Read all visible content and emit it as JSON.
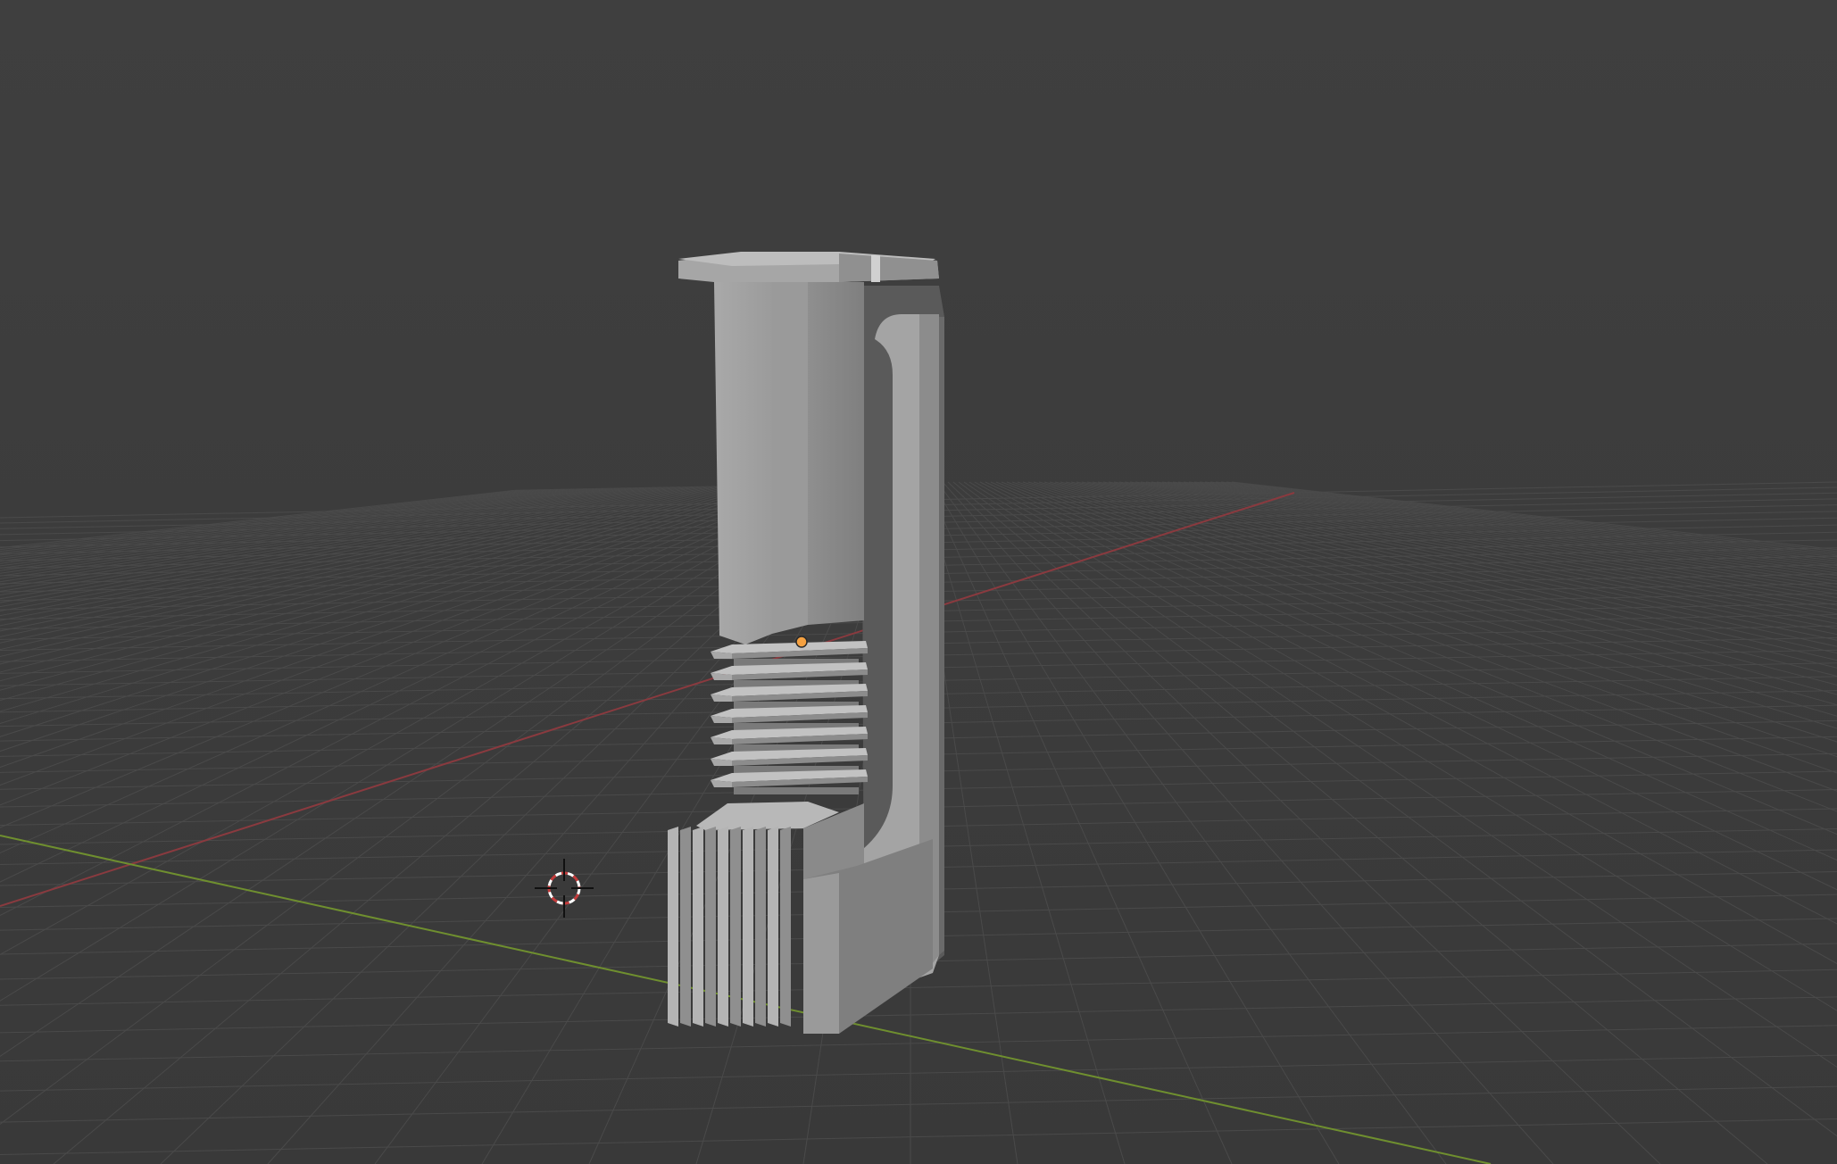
{
  "viewport": {
    "background_color": "#3d3d3d",
    "grid_color": "#4a4a4a",
    "x_axis_color": "#8a3a3f",
    "y_axis_color": "#6f8f2f",
    "selection_color": "#f5a141",
    "object_color": "#a9a9a9"
  },
  "icons": {
    "cursor": "3d-cursor-icon",
    "origin": "object-origin-icon"
  }
}
